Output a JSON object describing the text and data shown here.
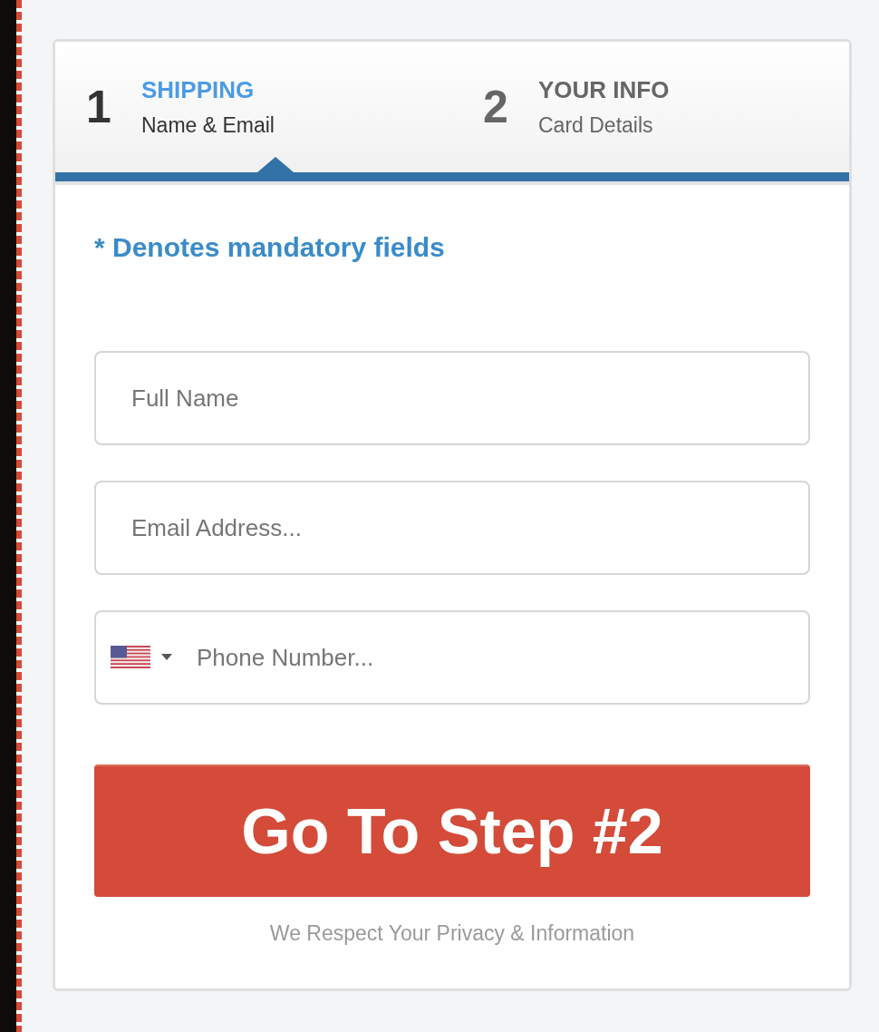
{
  "steps": [
    {
      "number": "1",
      "title": "SHIPPING",
      "subtitle": "Name & Email",
      "selected": true
    },
    {
      "number": "2",
      "title": "YOUR INFO",
      "subtitle": "Card Details",
      "selected": false
    }
  ],
  "notice": "* Denotes mandatory fields",
  "fields": [
    {
      "kind": "text",
      "placeholder": "Full Name"
    },
    {
      "kind": "text",
      "placeholder": "Email Address..."
    },
    {
      "kind": "phone",
      "placeholder": "Phone Number..."
    }
  ],
  "submit_button": "Go To Step #2",
  "privacy_note": "We Respect Your Privacy & Information"
}
